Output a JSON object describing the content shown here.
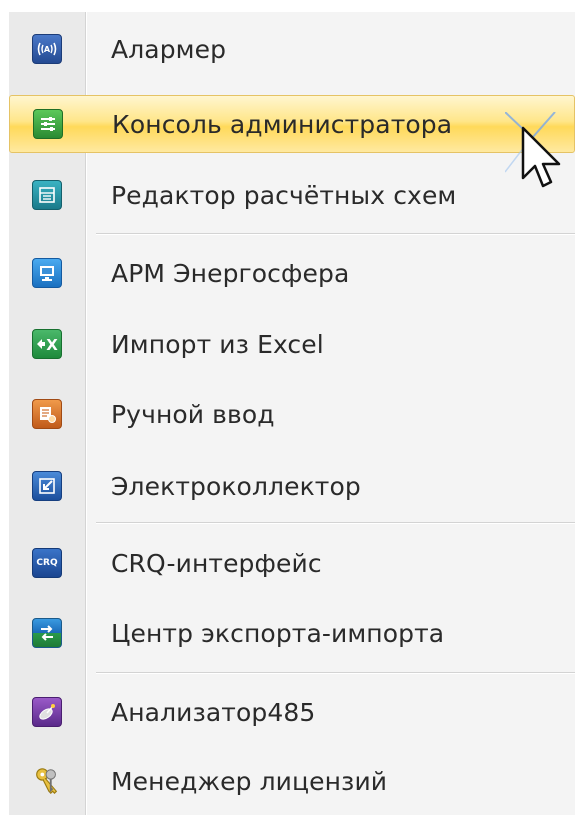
{
  "menu": {
    "items": [
      {
        "label": "Алармер",
        "icon": "alarm-antenna-icon",
        "color": "#2f5aa8"
      },
      {
        "label": "Консоль администратора",
        "icon": "admin-console-sliders-icon",
        "color": "#2e9a3a",
        "highlighted": true
      },
      {
        "label": "Редактор расчётных схем",
        "icon": "calc-scheme-editor-icon",
        "color": "#1f8ea0"
      },
      {
        "label": "АРМ Энергосфера",
        "icon": "monitor-icon",
        "color": "#1e88d8"
      },
      {
        "label": "Импорт из Excel",
        "icon": "excel-import-icon",
        "color": "#2a9a4a"
      },
      {
        "label": "Ручной ввод",
        "icon": "manual-input-icon",
        "color": "#d9782a"
      },
      {
        "label": "Электроколлектор",
        "icon": "electrocollector-icon",
        "color": "#2a64b8"
      },
      {
        "label": "CRQ-интерфейс",
        "icon": "crq-interface-icon",
        "color": "#2a5fae",
        "icon_text": "CRQ"
      },
      {
        "label": "Центр экспорта-импорта",
        "icon": "export-import-center-icon",
        "color": "#2a8ad0"
      },
      {
        "label": "Анализатор485",
        "icon": "analyzer-satellite-icon",
        "color": "#7a3a9a"
      },
      {
        "label": "Менеджер лицензий",
        "icon": "license-keys-icon",
        "color": "#c9a520"
      }
    ]
  },
  "colors": {
    "highlight": "#ffe07a",
    "gutter": "#eaeaea",
    "background": "#f4f4f4"
  }
}
